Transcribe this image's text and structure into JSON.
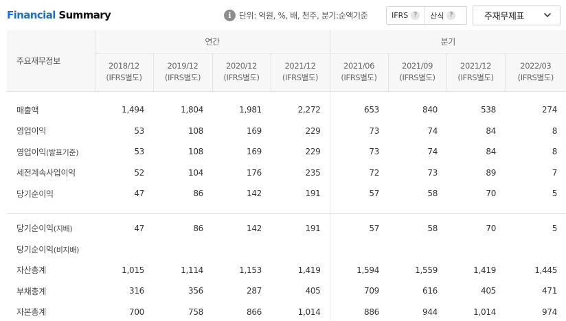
{
  "header": {
    "title_part1": "Financial",
    "title_part2": "Summary",
    "unit_text": "단위: 억원, %, 배, 천주, 분기:순액기준",
    "toggle": [
      {
        "label": "IFRS"
      },
      {
        "label": "산식"
      }
    ],
    "dropdown_label": "주재무제표"
  },
  "table": {
    "row_header": "주요재무정보",
    "groups": [
      {
        "label": "연간"
      },
      {
        "label": "분기"
      }
    ],
    "periods": [
      {
        "date": "2018/12",
        "basis": "(IFRS별도)"
      },
      {
        "date": "2019/12",
        "basis": "(IFRS별도)"
      },
      {
        "date": "2020/12",
        "basis": "(IFRS별도)"
      },
      {
        "date": "2021/12",
        "basis": "(IFRS별도)"
      },
      {
        "date": "2021/06",
        "basis": "(IFRS별도)"
      },
      {
        "date": "2021/09",
        "basis": "(IFRS별도)"
      },
      {
        "date": "2021/12",
        "basis": "(IFRS별도)"
      },
      {
        "date": "2022/03",
        "basis": "(IFRS별도)"
      }
    ],
    "section1": [
      {
        "label": "매출액",
        "label_small": "",
        "values": [
          "1,494",
          "1,804",
          "1,981",
          "2,272",
          "653",
          "840",
          "538",
          "274"
        ]
      },
      {
        "label": "영업이익",
        "label_small": "",
        "values": [
          "53",
          "108",
          "169",
          "229",
          "73",
          "74",
          "84",
          "8"
        ]
      },
      {
        "label": "영업이익",
        "label_small": "(발표기준)",
        "values": [
          "53",
          "108",
          "169",
          "229",
          "73",
          "74",
          "84",
          "8"
        ]
      },
      {
        "label": "세전계속사업이익",
        "label_small": "",
        "values": [
          "52",
          "104",
          "176",
          "235",
          "72",
          "73",
          "89",
          "7"
        ]
      },
      {
        "label": "당기순이익",
        "label_small": "",
        "values": [
          "47",
          "86",
          "142",
          "191",
          "57",
          "58",
          "70",
          "5"
        ]
      }
    ],
    "section2": [
      {
        "label": "당기순이익",
        "label_small": "(지배)",
        "values": [
          "47",
          "86",
          "142",
          "191",
          "57",
          "58",
          "70",
          "5"
        ]
      },
      {
        "label": "당기순이익",
        "label_small": "(비지배)",
        "values": [
          "",
          "",
          "",
          "",
          "",
          "",
          "",
          ""
        ]
      },
      {
        "label": "자산총계",
        "label_small": "",
        "values": [
          "1,015",
          "1,114",
          "1,153",
          "1,419",
          "1,594",
          "1,559",
          "1,419",
          "1,445"
        ]
      },
      {
        "label": "부채총계",
        "label_small": "",
        "values": [
          "316",
          "356",
          "287",
          "405",
          "709",
          "616",
          "405",
          "471"
        ]
      },
      {
        "label": "자본총계",
        "label_small": "",
        "values": [
          "700",
          "758",
          "866",
          "1,014",
          "886",
          "944",
          "1,014",
          "974"
        ]
      }
    ]
  }
}
